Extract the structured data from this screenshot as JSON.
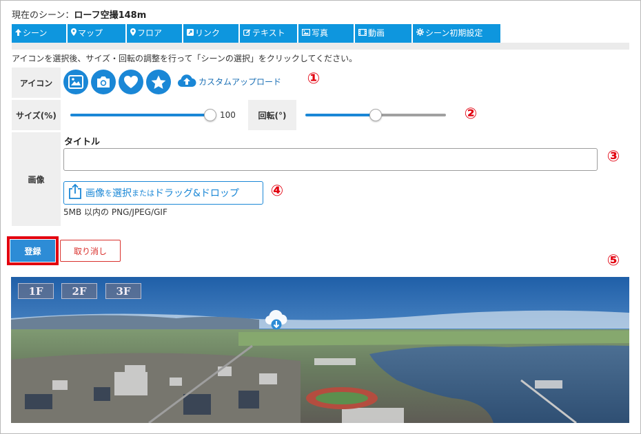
{
  "scene": {
    "prefix": "現在のシーン：",
    "name": "ローフ空撮148m"
  },
  "tabs": [
    {
      "label": "シーン",
      "icon": "arrow-up-icon"
    },
    {
      "label": "マップ",
      "icon": "map-pin-icon"
    },
    {
      "label": "フロア",
      "icon": "map-pin-icon"
    },
    {
      "label": "リンク",
      "icon": "link-square-icon"
    },
    {
      "label": "テキスト",
      "icon": "edit-icon"
    },
    {
      "label": "写真",
      "icon": "image-icon"
    },
    {
      "label": "動画",
      "icon": "film-icon"
    },
    {
      "label": "シーン初期設定",
      "icon": "gear-icon"
    }
  ],
  "instruction": "アイコンを選択後、サイズ・回転の調整を行って「シーンの選択」をクリックしてください。",
  "icon_row": {
    "label": "アイコン",
    "options": [
      "image-icon",
      "camera-icon",
      "heart-icon",
      "star-icon"
    ],
    "custom_upload": "カスタムアップロード"
  },
  "size": {
    "label": "サイズ(%)",
    "value": "100",
    "fraction": 1.0
  },
  "rotation": {
    "label": "回転(°)",
    "fraction": 0.5
  },
  "image_section": {
    "label": "画像",
    "title_label": "タイトル",
    "title_value": "",
    "drop_part1": "画像",
    "drop_part2": "を",
    "drop_part3": "選択",
    "drop_part4": "または",
    "drop_part5": "ドラッグ&ドロップ",
    "file_hint": "5MB 以内の PNG/JPEG/GIF"
  },
  "buttons": {
    "register": "登録",
    "cancel": "取り消し"
  },
  "markers": [
    "①",
    "②",
    "③",
    "④",
    "⑤"
  ],
  "panorama": {
    "floors": [
      "1F",
      "2F",
      "3F"
    ]
  },
  "colors": {
    "accent": "#0e96de",
    "primary_button": "#2d8cd6",
    "marker_red": "#e2000f",
    "cancel_red": "#d9302c"
  }
}
